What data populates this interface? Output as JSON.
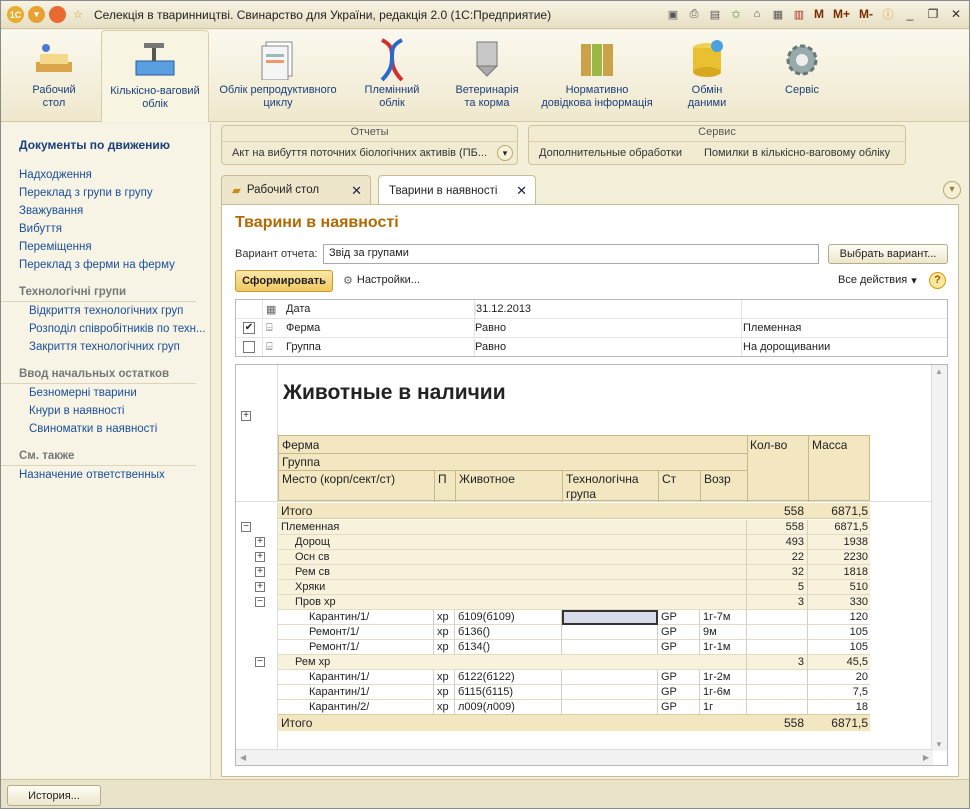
{
  "window": {
    "title": "Селекція в тваринництві. Свинарство для України, редакція 2.0  (1С:Предприятие)"
  },
  "titlebar_icons": [
    "logo-icon",
    "dropdown-circle-icon",
    "orange-circle-icon",
    "star-icon",
    "save-icon",
    "print-icon",
    "preview-icon",
    "favorite-add-icon",
    "favorites-icon",
    "calculator-icon",
    "calendar-icon",
    "help-icon",
    "minimize-icon",
    "restore-icon",
    "close-icon"
  ],
  "memory": {
    "m": "M",
    "mplus": "M+",
    "mminus": "M-"
  },
  "sections": [
    {
      "label": "Рабочий\nстол",
      "icon": "desk-icon"
    },
    {
      "label": "Кількісно-ваговий\nоблік",
      "icon": "scales-icon"
    },
    {
      "label": "Облік репродуктивного\nциклу",
      "icon": "documents-icon"
    },
    {
      "label": "Племінний\nоблік",
      "icon": "dna-icon"
    },
    {
      "label": "Ветеринарія\nта корма",
      "icon": "silo-icon"
    },
    {
      "label": "Нормативно\nдовідкова інформація",
      "icon": "binders-icon"
    },
    {
      "label": "Обмін\nданими",
      "icon": "database-icon"
    },
    {
      "label": "Сервіс",
      "icon": "gear-icon"
    }
  ],
  "left": {
    "heading": "Документы по движению",
    "links": [
      "Надходження",
      "Переклад з групи в групу",
      "Зважування",
      "Вибуття",
      "Переміщення",
      "Переклад з ферми на ферму"
    ],
    "group1": "Технологічні групи",
    "group1_links": [
      "Відкриття технологічних груп",
      "Розподіл співробітників по техн...",
      "Закриття технологічних груп"
    ],
    "group2": "Ввод начальных остатков",
    "group2_links": [
      "Безномерні тварини",
      "Кнури в наявності",
      "Свиноматки в наявності"
    ],
    "group3": "См. также",
    "group3_links": [
      "Назначение ответственных"
    ]
  },
  "groups": {
    "reports": {
      "title": "Отчеты",
      "item": "Акт на вибуття поточних біологічних активів (ПБ..."
    },
    "service": {
      "title": "Сервис",
      "items": [
        "Дополнительные обработки",
        "Помилки в кількісно-ваговому обліку"
      ]
    }
  },
  "tabs": [
    {
      "label": "Рабочий стол"
    },
    {
      "label": "Тварини в наявності"
    }
  ],
  "report": {
    "title": "Тварини в наявності",
    "variant_label": "Вариант отчета:",
    "variant_value": "Звід за групами",
    "choose_variant": "Выбрать вариант...",
    "generate": "Сформировать",
    "settings": "Настройки...",
    "all_actions": "Все действия",
    "help": "?",
    "filters": [
      {
        "checked": "",
        "name": "Дата",
        "cond": "31.12.2013",
        "value": ""
      },
      {
        "checked": "✔",
        "name": "Ферма",
        "cond": "Равно",
        "value": "Племенная"
      },
      {
        "checked": "",
        "name": "Группа",
        "cond": "Равно",
        "value": "На дорощивании"
      }
    ],
    "doc_title": "Животные в наличии",
    "headers": {
      "farm": "Ферма",
      "group": "Группа",
      "place": "Место (корп/сект/ст)",
      "p": "П",
      "animal": "Животное",
      "techgroup": "Технологічна\nгрупа",
      "st": "Ст",
      "age": "Возр",
      "count": "Кол-во",
      "mass": "Масса"
    },
    "total_label": "Итого",
    "total_count": "558",
    "total_mass": "6871,5",
    "rows": [
      {
        "level": 0,
        "toggle": "−",
        "name": "Племенная",
        "count": "558",
        "mass": "6871,5"
      },
      {
        "level": 1,
        "toggle": "+",
        "name": "Дорощ",
        "count": "493",
        "mass": "1938"
      },
      {
        "level": 1,
        "toggle": "+",
        "name": "Осн св",
        "count": "22",
        "mass": "2230"
      },
      {
        "level": 1,
        "toggle": "+",
        "name": "Рем св",
        "count": "32",
        "mass": "1818"
      },
      {
        "level": 1,
        "toggle": "+",
        "name": "Хряки",
        "count": "5",
        "mass": "510"
      },
      {
        "level": 1,
        "toggle": "−",
        "name": "Пров хр",
        "count": "3",
        "mass": "330"
      },
      {
        "level": 2,
        "toggle": "",
        "name": "Карантин/1/",
        "p": "хр",
        "animal": "б109(б109)",
        "st": "GP",
        "age": "1г-7м",
        "count": "",
        "mass": "120"
      },
      {
        "level": 2,
        "toggle": "",
        "name": "Ремонт/1/",
        "p": "хр",
        "animal": "б136()",
        "st": "GP",
        "age": "9м",
        "count": "",
        "mass": "105"
      },
      {
        "level": 2,
        "toggle": "",
        "name": "Ремонт/1/",
        "p": "хр",
        "animal": "б134()",
        "st": "GP",
        "age": "1г-1м",
        "count": "",
        "mass": "105"
      },
      {
        "level": 1,
        "toggle": "−",
        "name": "Рем хр",
        "count": "3",
        "mass": "45,5"
      },
      {
        "level": 2,
        "toggle": "",
        "name": "Карантин/1/",
        "p": "хр",
        "animal": "б122(б122)",
        "st": "GP",
        "age": "1г-2м",
        "count": "",
        "mass": "20"
      },
      {
        "level": 2,
        "toggle": "",
        "name": "Карантин/1/",
        "p": "хр",
        "animal": "б115(б115)",
        "st": "GP",
        "age": "1г-6м",
        "count": "",
        "mass": "7,5"
      },
      {
        "level": 2,
        "toggle": "",
        "name": "Карантин/2/",
        "p": "хр",
        "animal": "л009(л009)",
        "st": "GP",
        "age": "1г",
        "count": "",
        "mass": "18"
      }
    ]
  },
  "status": {
    "history": "История..."
  },
  "colors": {
    "accent_title": "#b06a00",
    "header_bg": "#f2e7c0",
    "link": "#1a4f9a"
  }
}
